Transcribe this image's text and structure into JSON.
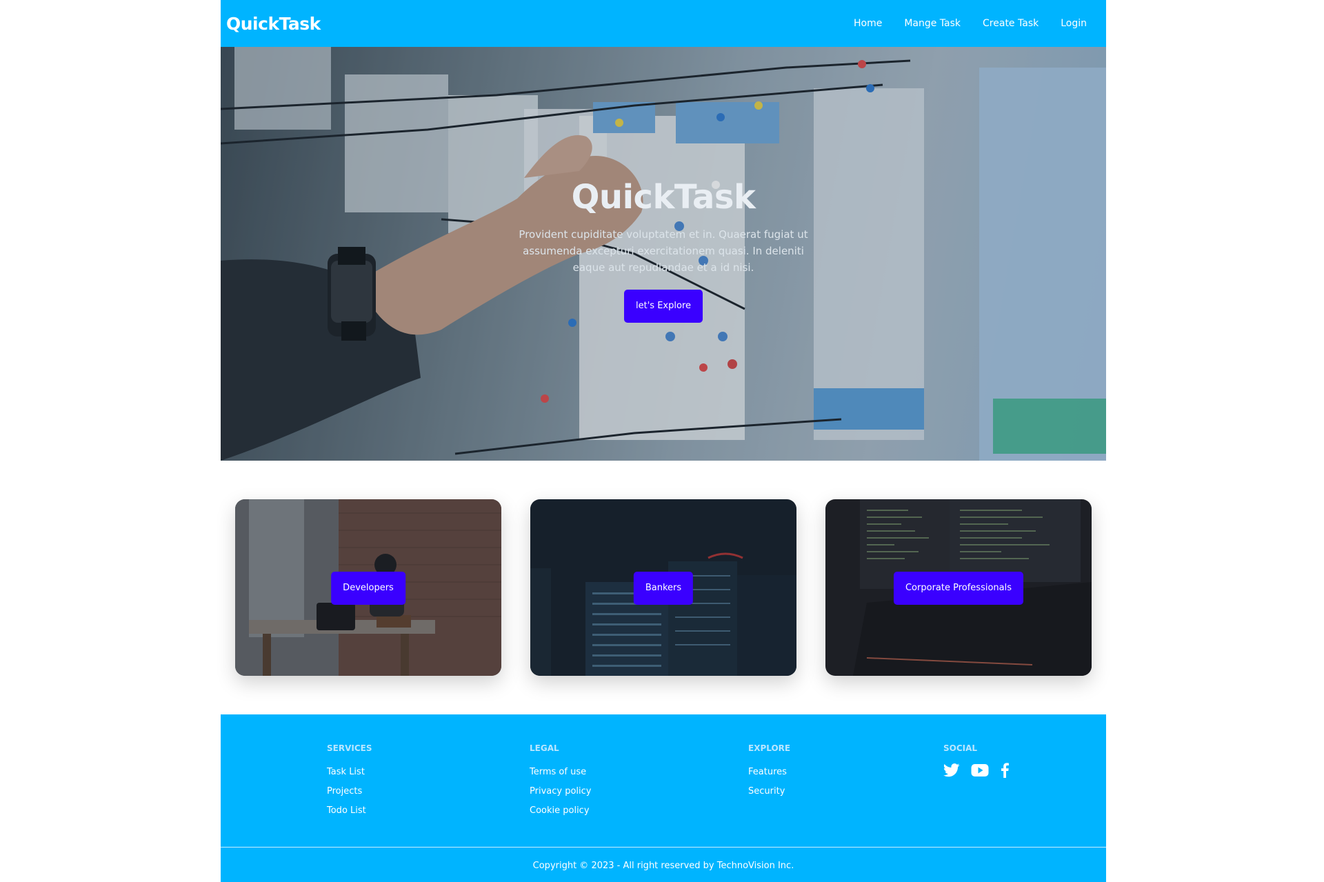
{
  "navbar": {
    "brand": "QuickTask",
    "links": [
      "Home",
      "Mange Task",
      "Create Task",
      "Login"
    ]
  },
  "hero": {
    "title": "QuickTask",
    "description": "Provident cupiditate voluptatem et in. Quaerat fugiat ut assumenda excepturi exercitationem quasi. In deleniti eaque aut repudiandae et a id nisi.",
    "button": "let's Explore"
  },
  "cards": [
    {
      "label": "Developers"
    },
    {
      "label": "Bankers"
    },
    {
      "label": "Corporate Professionals"
    }
  ],
  "footer": {
    "columns": [
      {
        "heading": "SERVICES",
        "links": [
          "Task List",
          "Projects",
          "Todo List"
        ]
      },
      {
        "heading": "LEGAL",
        "links": [
          "Terms of use",
          "Privacy policy",
          "Cookie policy"
        ]
      },
      {
        "heading": "EXPLORE",
        "links": [
          "Features",
          "Security"
        ]
      },
      {
        "heading": "SOCIAL",
        "icons": [
          "twitter-icon",
          "youtube-icon",
          "facebook-icon"
        ]
      }
    ],
    "copyright": "Copyright © 2023 - All right reserved by TechnoVision Inc."
  },
  "colors": {
    "primary": "#00b4ff",
    "accent_button": "#3a00ff"
  }
}
